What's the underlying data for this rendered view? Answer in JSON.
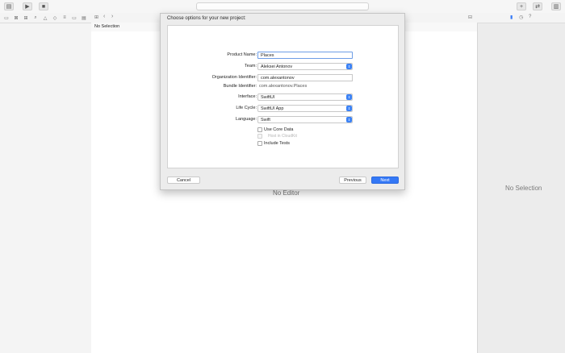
{
  "toolbar": {
    "icons": [
      "sidebar-icon",
      "run-icon",
      "stop-icon",
      "add-icon",
      "code-review-icon",
      "inspector-toggle-icon"
    ]
  },
  "navigator": {
    "icons": [
      "folder-icon",
      "source-control-icon",
      "symbol-icon",
      "find-icon",
      "issue-icon",
      "test-icon",
      "debug-icon",
      "breakpoint-icon",
      "report-icon"
    ]
  },
  "editor": {
    "jump_bar_text": "No Selection",
    "placeholder": "No Editor"
  },
  "inspector": {
    "placeholder": "No Selection",
    "icons": [
      "file-inspector-icon",
      "history-icon",
      "help-icon"
    ]
  },
  "sheet": {
    "title": "Choose options for your new project:",
    "fields": {
      "product_name": {
        "label": "Product Name:",
        "value": "Places"
      },
      "team": {
        "label": "Team:",
        "value": "Aleksei Antonov"
      },
      "org_id": {
        "label": "Organization Identifier:",
        "value": "com.alexantonov"
      },
      "bundle_id": {
        "label": "Bundle Identifier:",
        "value": "com.alexantonov.Places"
      },
      "interface": {
        "label": "Interface:",
        "value": "SwiftUI"
      },
      "life_cycle": {
        "label": "Life Cycle:",
        "value": "SwiftUI App"
      },
      "language": {
        "label": "Language:",
        "value": "Swift"
      }
    },
    "checkboxes": {
      "core_data": "Use Core Data",
      "cloudkit": "Host in CloudKit",
      "tests": "Include Tests"
    },
    "buttons": {
      "cancel": "Cancel",
      "previous": "Previous",
      "next": "Next"
    }
  },
  "colors": {
    "accent": "#3478f6",
    "focus_ring": "#6d9de6"
  }
}
